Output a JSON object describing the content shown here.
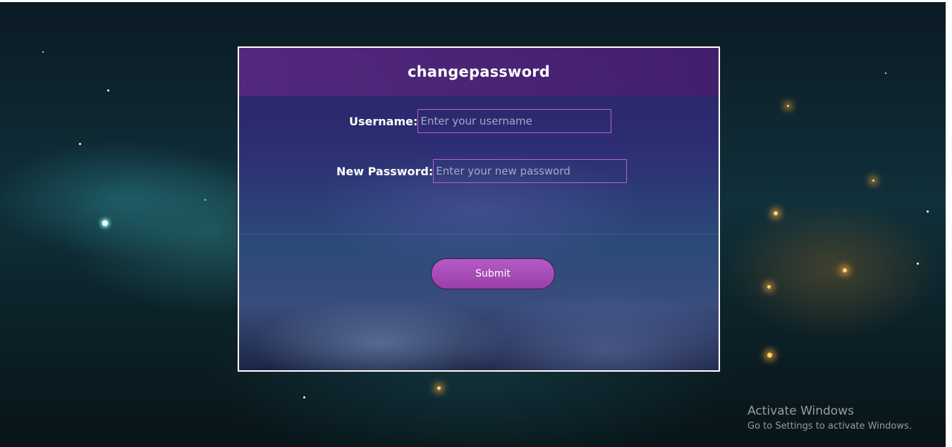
{
  "form": {
    "title": "changepassword",
    "username": {
      "label": "Username:",
      "placeholder": "Enter your username",
      "value": ""
    },
    "new_password": {
      "label": "New Password:",
      "placeholder": "Enter your new password",
      "value": ""
    },
    "submit_label": "Submit"
  },
  "watermark": {
    "title": "Activate Windows",
    "subtitle": "Go to Settings to activate Windows."
  },
  "colors": {
    "header_bg": "#5a2882",
    "input_border": "#c05ad8",
    "button_bg": "#a84cb8",
    "text": "#ffffff"
  }
}
